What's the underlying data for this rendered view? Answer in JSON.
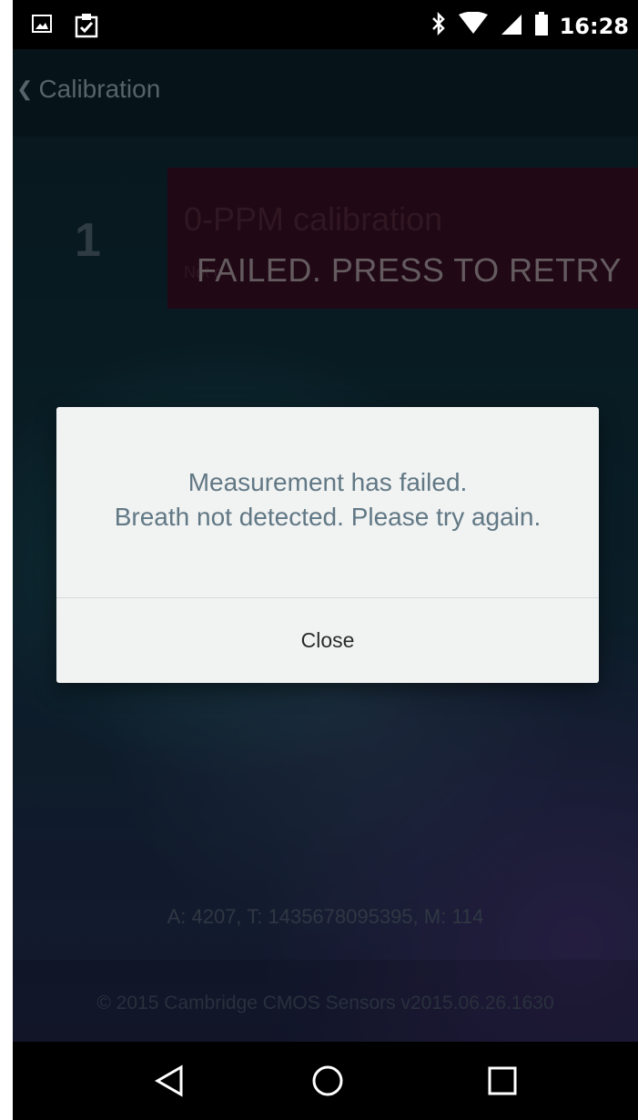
{
  "status_bar": {
    "time": "16:28",
    "icons": [
      "image-icon",
      "clipboard-check-icon",
      "bluetooth-icon",
      "wifi-icon",
      "cellular-roaming-icon",
      "battery-icon"
    ],
    "roaming_label": "R"
  },
  "header": {
    "back_label": "Calibration",
    "back_icon": "chevron-left-icon"
  },
  "step": {
    "number": "1",
    "title": "0-PPM calibration",
    "subtitle": "Not c",
    "status": "FAILED. PRESS TO RETRY"
  },
  "dialog": {
    "message_line1": "Measurement has failed.",
    "message_line2": "Breath not detected. Please try again.",
    "close_label": "Close"
  },
  "telemetry": "A: 4207, T: 1435678095395, M: 114",
  "footer": "© 2015 Cambridge CMOS Sensors v2015.06.26.1630",
  "nav_bar": {
    "icons": [
      "back-triangle-icon",
      "home-circle-icon",
      "recents-square-icon"
    ]
  },
  "colors": {
    "step_card_bg": "#3b0f26",
    "dialog_bg": "#f1f2f2",
    "dialog_text": "#617885"
  }
}
